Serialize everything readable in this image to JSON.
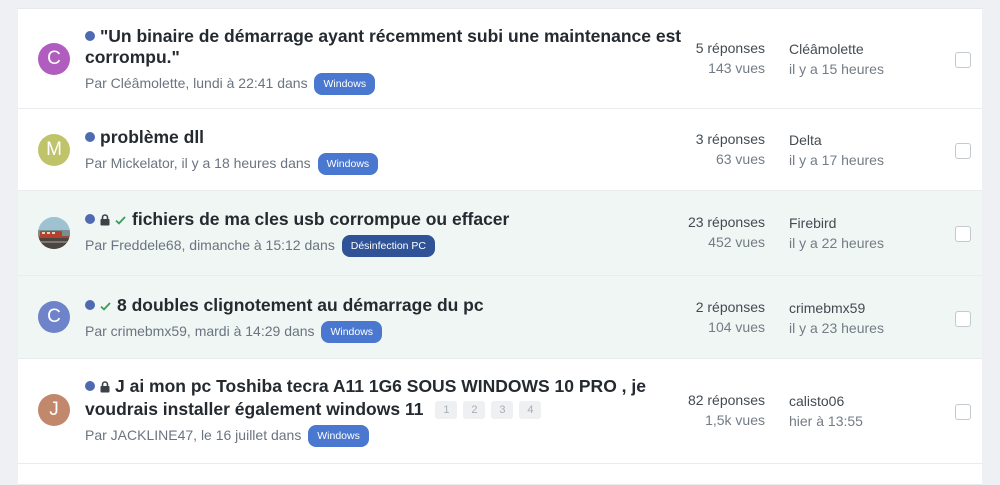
{
  "topics": [
    {
      "avatar_letter": "C",
      "avatar_color": "#b15cbf",
      "title": "\"Un binaire de démarrage ayant récemment subi une maintenance est corrompu.\"",
      "meta_prefix": "Par Cléâmolette, lundi à 22:41 dans",
      "tag": "Windows",
      "replies": "5 réponses",
      "views": "143 vues",
      "last_author": "Cléâmolette",
      "last_time": "il y a 15 heures",
      "icons": [
        "unread-dot"
      ]
    },
    {
      "avatar_letter": "M",
      "avatar_color": "#bfc46a",
      "title": "problème dll",
      "meta_prefix": "Par Mickelator, il y a 18 heures dans",
      "tag": "Windows",
      "replies": "3 réponses",
      "views": "63 vues",
      "last_author": "Delta",
      "last_time": "il y a 17 heures",
      "icons": [
        "unread-dot"
      ]
    },
    {
      "avatar_letter": "",
      "avatar_color": "",
      "title": "fichiers de ma cles usb corrompue ou effacer",
      "meta_prefix": "Par Freddele68, dimanche à 15:12 dans",
      "tag": "Désinfection PC",
      "replies": "23 réponses",
      "views": "452 vues",
      "last_author": "Firebird",
      "last_time": "il y a 22 heures",
      "icons": [
        "unread-dot",
        "lock",
        "check"
      ]
    },
    {
      "avatar_letter": "C",
      "avatar_color": "#6e83c9",
      "title": "8 doubles clignotement au démarrage du pc",
      "meta_prefix": "Par crimebmx59, mardi à 14:29 dans",
      "tag": "Windows",
      "replies": "2 réponses",
      "views": "104 vues",
      "last_author": "crimebmx59",
      "last_time": "il y a 23 heures",
      "icons": [
        "unread-dot",
        "check"
      ]
    },
    {
      "avatar_letter": "J",
      "avatar_color": "#c1886c",
      "title": "J ai mon pc Toshiba tecra A11 1G6 SOUS WINDOWS 10 PRO , je voudrais installer également windows 11",
      "meta_prefix": "Par JACKLINE47, le 16 juillet dans",
      "tag": "Windows",
      "replies": "82 réponses",
      "views": "1,5k vues",
      "last_author": "calisto06",
      "last_time": "hier à 13:55",
      "pages": [
        "1",
        "2",
        "3",
        "4"
      ],
      "icons": [
        "unread-dot",
        "lock"
      ]
    }
  ],
  "colors": {
    "solved_row_bg": "#f0f6f3",
    "tag_bg": "#4a78d0",
    "tag_dark_bg": "#2f5396",
    "unread_dot": "#4f6ab0"
  }
}
